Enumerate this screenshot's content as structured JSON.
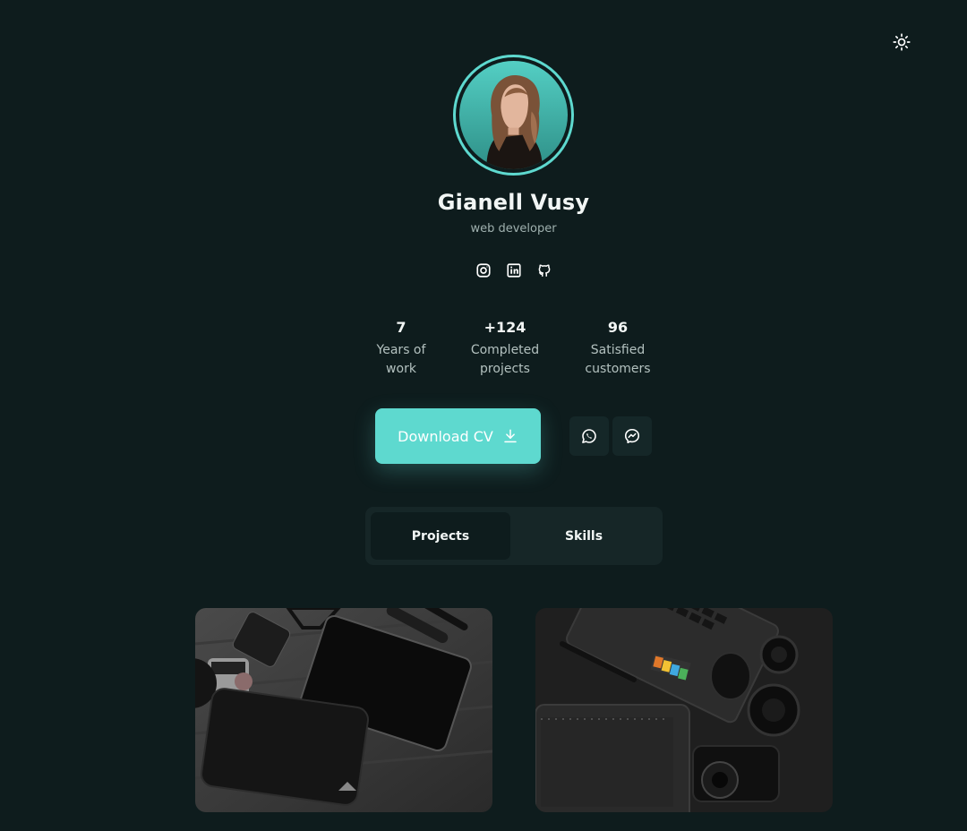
{
  "header": {
    "theme_toggle_icon": "sun-icon"
  },
  "profile": {
    "name": "Gianell Vusy",
    "role": "web developer"
  },
  "socials": [
    "instagram-icon",
    "linkedin-icon",
    "github-icon"
  ],
  "stats": [
    {
      "value": "7",
      "label": "Years of work"
    },
    {
      "value": "+124",
      "label": "Completed projects"
    },
    {
      "value": "96",
      "label": "Satisfied customers"
    }
  ],
  "actions": {
    "download_label": "Download CV",
    "download_icon": "download-icon",
    "contact_icons": [
      "whatsapp-icon",
      "messenger-icon"
    ]
  },
  "tabs": [
    {
      "label": "Projects",
      "active": true
    },
    {
      "label": "Skills",
      "active": false
    }
  ],
  "colors": {
    "background": "#0e1c1d",
    "accent": "#5ed9cf",
    "surface": "#162627"
  }
}
